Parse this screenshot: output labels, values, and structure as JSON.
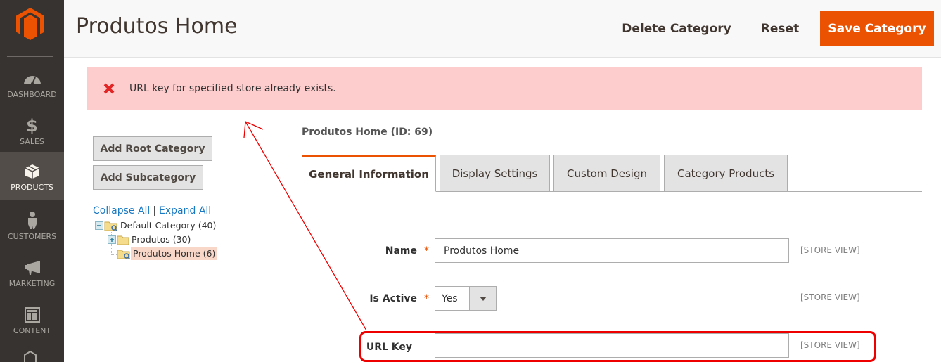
{
  "sidebar": {
    "logo": "magento-logo",
    "items": [
      {
        "label": "DASHBOARD",
        "icon": "dashboard-icon",
        "active": false
      },
      {
        "label": "SALES",
        "icon": "dollar-icon",
        "active": false
      },
      {
        "label": "PRODUCTS",
        "icon": "box-icon",
        "active": true
      },
      {
        "label": "CUSTOMERS",
        "icon": "person-icon",
        "active": false
      },
      {
        "label": "MARKETING",
        "icon": "megaphone-icon",
        "active": false
      },
      {
        "label": "CONTENT",
        "icon": "layout-icon",
        "active": false
      }
    ]
  },
  "header": {
    "title": "Produtos Home",
    "delete_label": "Delete Category",
    "reset_label": "Reset",
    "save_label": "Save Category"
  },
  "message": {
    "type": "error",
    "icon": "error-x-icon",
    "text": "URL key for specified store already exists."
  },
  "left": {
    "add_root_label": "Add Root Category",
    "add_sub_label": "Add Subcategory",
    "collapse_all": "Collapse All",
    "separator": "|",
    "expand_all": "Expand All",
    "tree": [
      {
        "label": "Default Category (40)",
        "level": 0,
        "expanded": true,
        "selected": false
      },
      {
        "label": "Produtos (30)",
        "level": 1,
        "expanded": false,
        "selected": false
      },
      {
        "label": "Produtos Home (6)",
        "level": 1,
        "expanded": false,
        "selected": true
      }
    ]
  },
  "main": {
    "category_title": "Produtos Home (ID: 69)",
    "tabs": [
      {
        "label": "General Information",
        "active": true
      },
      {
        "label": "Display Settings",
        "active": false
      },
      {
        "label": "Custom Design",
        "active": false
      },
      {
        "label": "Category Products",
        "active": false
      }
    ],
    "fields": {
      "name": {
        "label": "Name",
        "required": "*",
        "value": "Produtos Home",
        "scope": "[STORE VIEW]"
      },
      "is_active": {
        "label": "Is Active",
        "required": "*",
        "value": "Yes",
        "scope": "[STORE VIEW]"
      },
      "url_key": {
        "label": "URL Key",
        "value": "",
        "scope": "[STORE VIEW]"
      }
    }
  },
  "annotation": {
    "color": "#ef0000",
    "description": "red arrow from URL Key field to error message"
  },
  "colors": {
    "accent": "#eb5202",
    "sidebar_bg": "#373330",
    "error_bg": "#fdcccc",
    "error_icon": "#e22626"
  }
}
